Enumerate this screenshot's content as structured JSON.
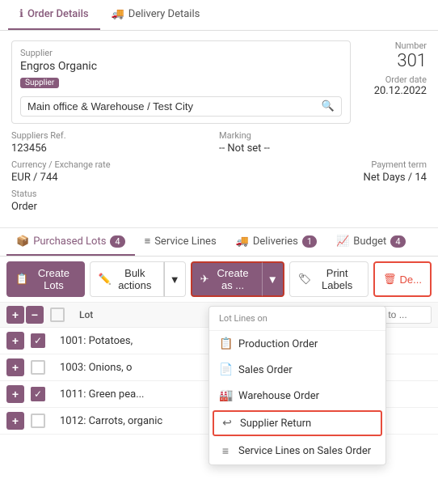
{
  "tabs": {
    "top": [
      {
        "id": "order-details",
        "label": "Order Details",
        "active": true,
        "icon": "ℹ"
      },
      {
        "id": "delivery-details",
        "label": "Delivery Details",
        "active": false,
        "icon": "🚚"
      }
    ]
  },
  "supplier": {
    "label": "Supplier",
    "name": "Engros Organic",
    "badge": "Supplier",
    "location": "Main office & Warehouse / Test City",
    "location_placeholder": "Main office & Warehouse / Test City"
  },
  "order_info": {
    "number_label": "Number",
    "number_value": "301",
    "date_label": "Order date",
    "date_value": "20.12.2022"
  },
  "suppliers_ref": {
    "label": "Suppliers Ref.",
    "value": "123456"
  },
  "marking": {
    "label": "Marking",
    "value": "-- Not set --"
  },
  "currency": {
    "label": "Currency / Exchange rate",
    "value": "EUR / 744"
  },
  "payment_term": {
    "label": "Payment term",
    "value": "Net Days / 14"
  },
  "status": {
    "label": "Status",
    "value": "Order"
  },
  "bottom_tabs": [
    {
      "id": "purchased-lots",
      "label": "Purchased Lots",
      "badge": "4",
      "active": true,
      "icon": "📦"
    },
    {
      "id": "service-lines",
      "label": "Service Lines",
      "badge": null,
      "active": false,
      "icon": "≡"
    },
    {
      "id": "deliveries",
      "label": "Deliveries",
      "badge": "1",
      "active": false,
      "icon": "🚚"
    },
    {
      "id": "budget",
      "label": "Budget",
      "badge": "4",
      "active": false,
      "icon": "📈"
    }
  ],
  "action_buttons": {
    "create_lots": "Create Lots",
    "bulk_actions": "Bulk actions",
    "create_as": "Create as ...",
    "print_labels": "Print Labels",
    "delete": "De..."
  },
  "table": {
    "header": {
      "lot_label": "Lot",
      "search_placeholder": "Type to ..."
    },
    "rows": [
      {
        "id": "row-1",
        "plus": true,
        "checked": false,
        "lot": "",
        "is_header": true
      },
      {
        "id": "row-2",
        "plus": true,
        "checked": true,
        "lot": "1001: Potatoes,",
        "truncated": true
      },
      {
        "id": "row-3",
        "plus": true,
        "checked": false,
        "lot": "1003: Onions, o",
        "truncated": true
      },
      {
        "id": "row-4",
        "plus": true,
        "checked": true,
        "lot": "1011: Green pea...",
        "truncated": true
      },
      {
        "id": "row-5",
        "plus": true,
        "checked": false,
        "lot": "1012: Carrots, organic",
        "truncated": false
      }
    ]
  },
  "dropdown": {
    "header": "Lot Lines on",
    "items": [
      {
        "id": "production-order",
        "label": "Production Order",
        "icon": "📋"
      },
      {
        "id": "sales-order",
        "label": "Sales Order",
        "icon": "📄"
      },
      {
        "id": "warehouse-order",
        "label": "Warehouse Order",
        "icon": "🏭"
      },
      {
        "id": "supplier-return",
        "label": "Supplier Return",
        "icon": "↩",
        "highlighted": true
      },
      {
        "id": "service-lines-sales",
        "label": "Service Lines on Sales Order",
        "icon": "≡"
      }
    ]
  }
}
